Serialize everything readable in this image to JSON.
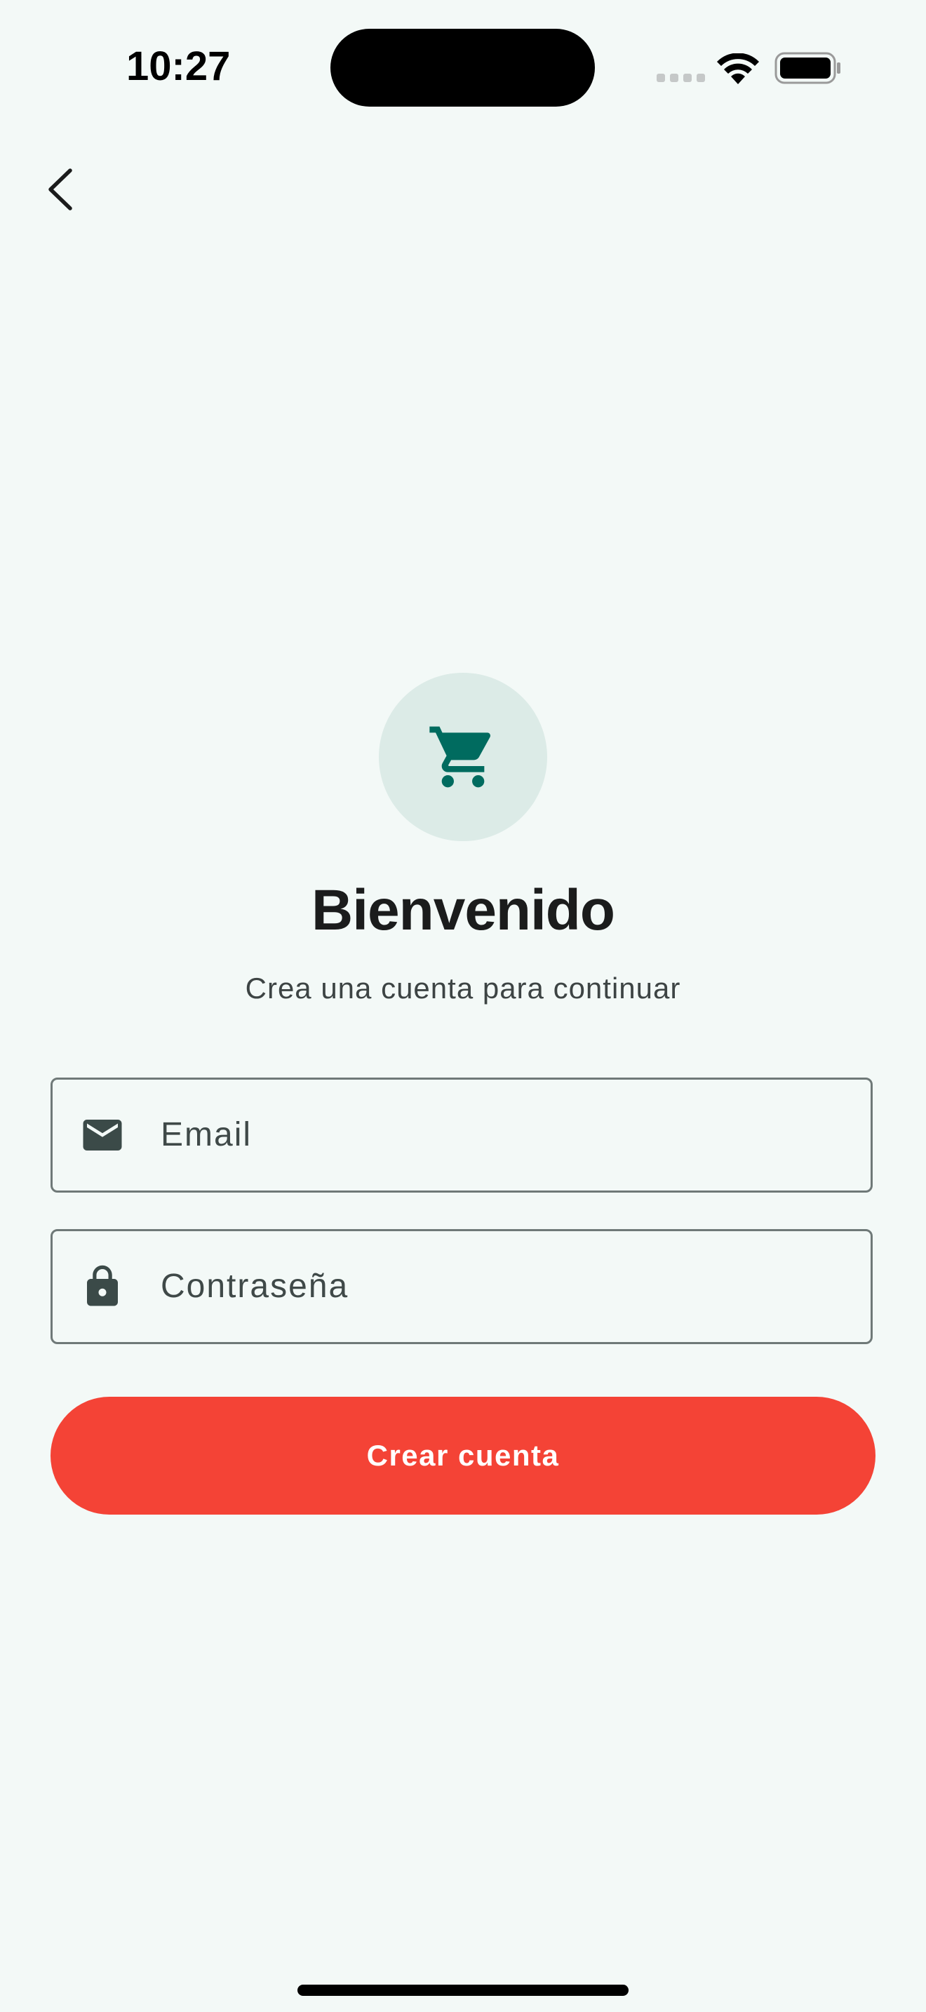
{
  "status_bar": {
    "time": "10:27",
    "icons": [
      "signal-icon",
      "wifi-icon",
      "battery-icon"
    ]
  },
  "navigation": {
    "back_icon": "chevron-left-icon"
  },
  "logo": {
    "icon": "shopping-cart-icon",
    "circle_color": "#dcebe7",
    "icon_color": "#006b5f"
  },
  "header": {
    "title": "Bienvenido",
    "subtitle": "Crea una cuenta para continuar"
  },
  "form": {
    "email": {
      "icon": "mail-icon",
      "placeholder": "Email",
      "value": ""
    },
    "password": {
      "icon": "lock-icon",
      "placeholder": "Contraseña",
      "value": ""
    },
    "submit_label": "Crear cuenta"
  },
  "colors": {
    "background": "#f3f9f7",
    "accent": "#f44336",
    "field_border": "#6f7978",
    "text_primary": "#1b1c1c",
    "text_secondary": "#3d4444"
  }
}
